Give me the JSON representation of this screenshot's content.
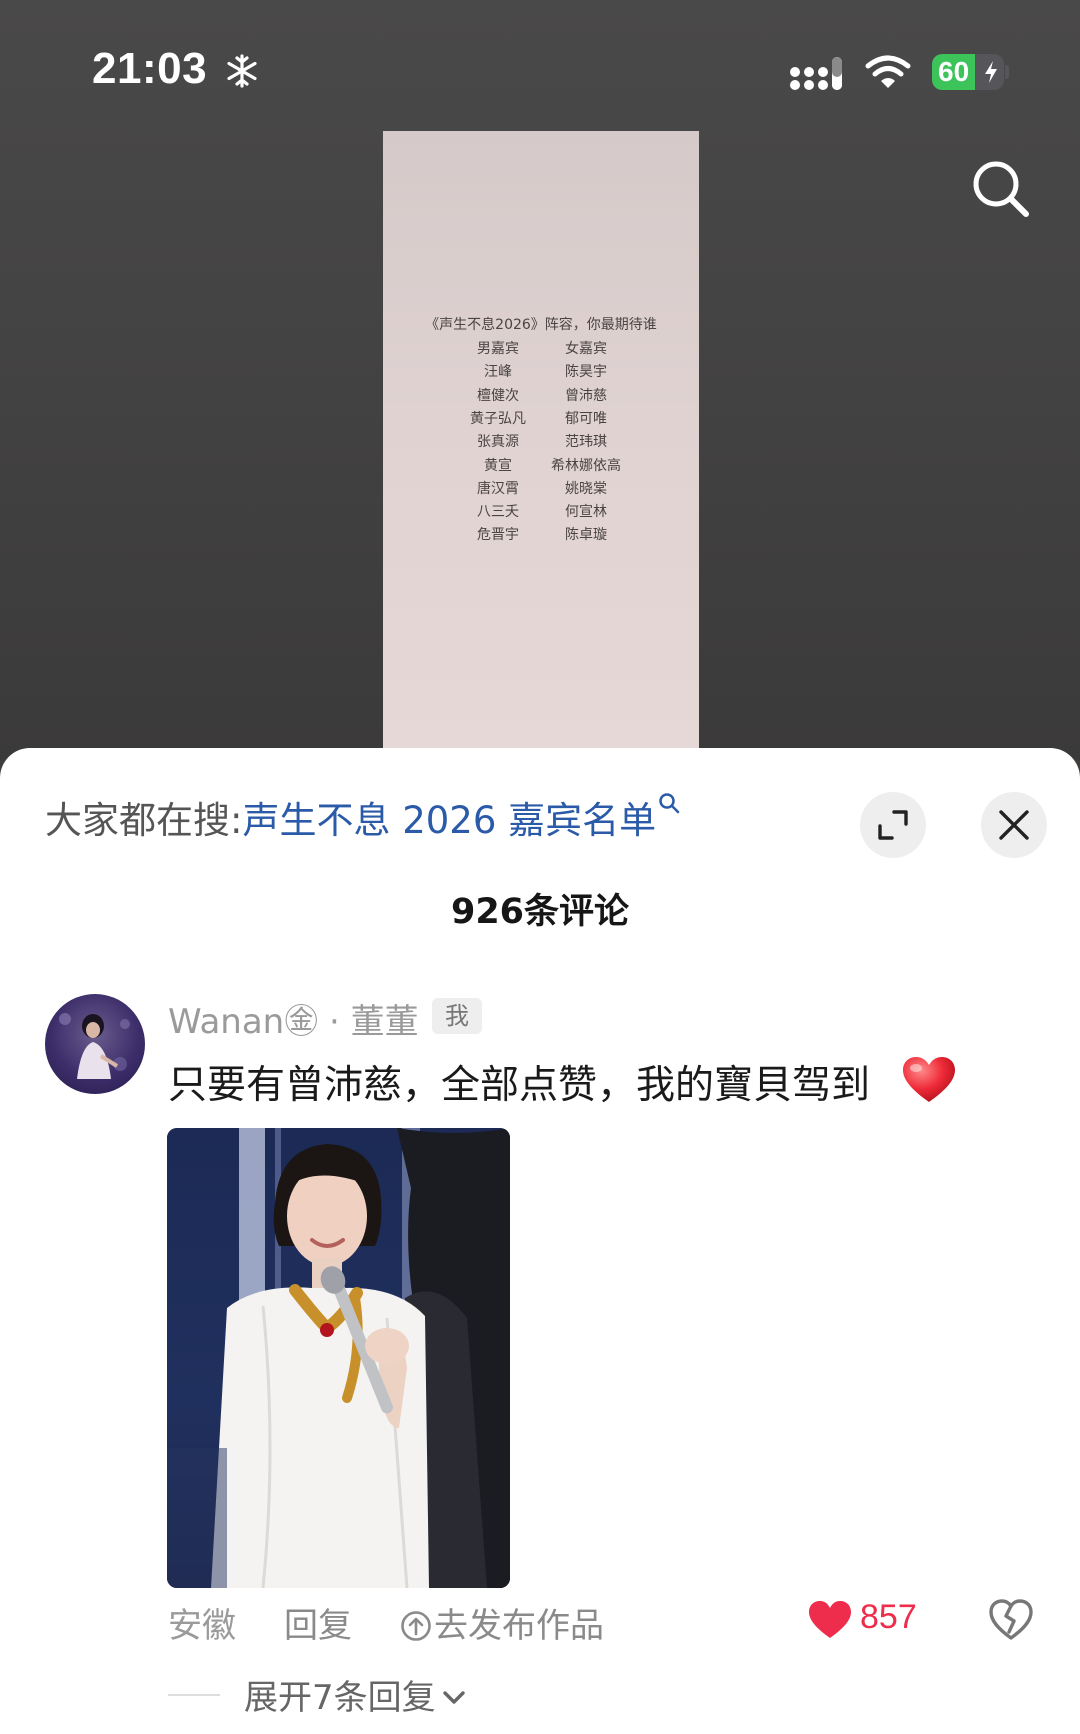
{
  "status_bar": {
    "time": "21:03",
    "battery": "60",
    "battery_level": 0.6
  },
  "poster": {
    "title": "《声生不息2026》阵容，你最期待谁",
    "col_headers": [
      "男嘉宾",
      "女嘉宾"
    ],
    "rows": [
      [
        "汪峰",
        "陈昊宇"
      ],
      [
        "檀健次",
        "曾沛慈"
      ],
      [
        "黄子弘凡",
        "郁可唯"
      ],
      [
        "张真源",
        "范玮琪"
      ],
      [
        "黄宣",
        "希林娜依高"
      ],
      [
        "唐汉霄",
        "姚晓棠"
      ],
      [
        "八三夭",
        "何宣林"
      ],
      [
        "危晋宇",
        "陈卓璇"
      ]
    ]
  },
  "sheet": {
    "hot_search_prefix": "大家都在搜:",
    "hot_search_term": "声生不息 2026 嘉宾名单",
    "comment_count": "926条评论"
  },
  "comment": {
    "username": "Wanan㊎ · 董董",
    "me_badge": "我",
    "text": "只要有曾沛慈，全部点赞，我的寶貝驾到",
    "location": "安徽",
    "reply_label": "回复",
    "publish_label": "去发布作品",
    "like_count": "857",
    "expand_label": "展开7条回复"
  },
  "colors": {
    "hot_search_term": "#2b5ba8",
    "like": "#ee2c4b",
    "battery": "#3cc35a"
  },
  "icons": [
    "snowflake-icon",
    "signal-icon",
    "wifi-icon",
    "search-icon",
    "expand-icon",
    "close-icon",
    "heart-emoji-icon",
    "upload-icon",
    "heart-icon",
    "broken-heart-icon",
    "chevron-down-icon"
  ]
}
